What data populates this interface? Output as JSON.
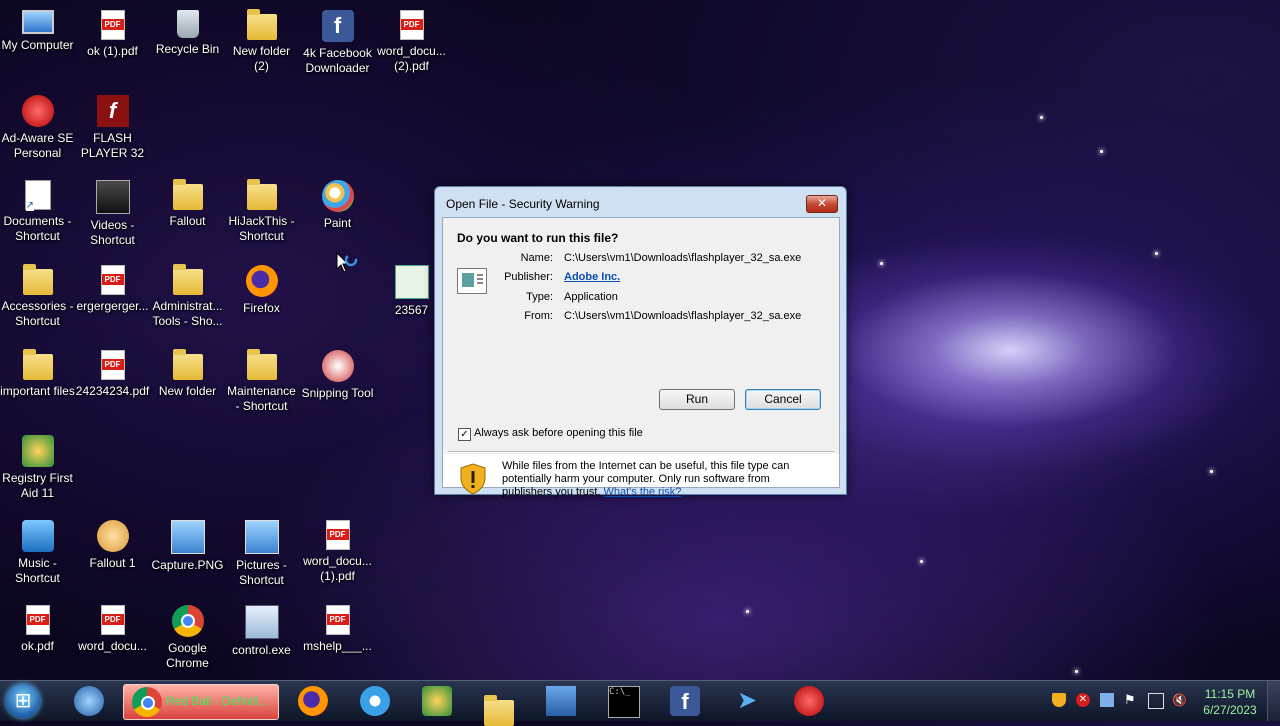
{
  "desktop": {
    "icons": [
      {
        "label": "My Computer",
        "icon": "my-computer-icon"
      },
      {
        "label": "ok (1).pdf",
        "icon": "pdf-icon"
      },
      {
        "label": "Recycle Bin",
        "icon": "recycle-bin-icon"
      },
      {
        "label": "New folder (2)",
        "icon": "folder-icon"
      },
      {
        "label": "4k Facebook Downloader",
        "icon": "facebook-downloader-icon"
      },
      {
        "label": "word_docu... (2).pdf",
        "icon": "pdf-icon"
      },
      {
        "label": "Ad-Aware SE Personal",
        "icon": "adaware-icon"
      },
      {
        "label": "FLASH PLAYER 32",
        "icon": "flash-player-icon"
      },
      {
        "label": "Documents - Shortcut",
        "icon": "documents-shortcut-icon"
      },
      {
        "label": "Videos - Shortcut",
        "icon": "videos-shortcut-icon"
      },
      {
        "label": "Fallout",
        "icon": "folder-icon"
      },
      {
        "label": "HiJackThis - Shortcut",
        "icon": "folder-shortcut-icon"
      },
      {
        "label": "Paint",
        "icon": "paint-icon"
      },
      {
        "label": "Accessories - Shortcut",
        "icon": "folder-shortcut-icon"
      },
      {
        "label": "ergergerger...",
        "icon": "pdf-icon"
      },
      {
        "label": "Administrat... Tools - Sho...",
        "icon": "folder-icon"
      },
      {
        "label": "Firefox",
        "icon": "firefox-icon"
      },
      {
        "label": "23567",
        "icon": "spreadsheet-icon"
      },
      {
        "label": "important files",
        "icon": "folder-shortcut-icon"
      },
      {
        "label": "24234234.pdf",
        "icon": "pdf-icon"
      },
      {
        "label": "New folder",
        "icon": "folder-icon"
      },
      {
        "label": "Maintenance - Shortcut",
        "icon": "folder-shortcut-icon"
      },
      {
        "label": "Snipping Tool",
        "icon": "snipping-tool-icon"
      },
      {
        "label": "Registry First Aid 11",
        "icon": "registry-first-aid-icon"
      },
      {
        "label": "Music - Shortcut",
        "icon": "music-shortcut-icon"
      },
      {
        "label": "Fallout 1",
        "icon": "fallout-icon"
      },
      {
        "label": "Capture.PNG",
        "icon": "png-file-icon"
      },
      {
        "label": "Pictures - Shortcut",
        "icon": "pictures-shortcut-icon"
      },
      {
        "label": "word_docu... (1).pdf",
        "icon": "pdf-icon"
      },
      {
        "label": "ok.pdf",
        "icon": "pdf-icon"
      },
      {
        "label": "word_docu...",
        "icon": "pdf-icon"
      },
      {
        "label": "Google Chrome",
        "icon": "chrome-icon"
      },
      {
        "label": "control.exe",
        "icon": "exe-icon"
      },
      {
        "label": "mshelp___...",
        "icon": "pdf-icon"
      }
    ]
  },
  "dialog": {
    "title": "Open File - Security Warning",
    "close_label": "✕",
    "question": "Do you want to run this file?",
    "name_key": "Name:",
    "name_value": "C:\\Users\\vm1\\Downloads\\flashplayer_32_sa.exe",
    "publisher_key": "Publisher:",
    "publisher_value": "Adobe Inc.",
    "type_key": "Type:",
    "type_value": "Application",
    "from_key": "From:",
    "from_value": "C:\\Users\\vm1\\Downloads\\flashplayer_32_sa.exe",
    "run_label": "Run",
    "cancel_label": "Cancel",
    "always_ask_label": "Always ask before opening this file",
    "always_ask_checked": "✓",
    "warning_text": "While files from the Internet can be useful, this file type can potentially harm your computer. Only run software from publishers you trust.",
    "risk_link": "What's the risk?"
  },
  "taskbar": {
    "active_window_label": "Red Ball - Definiti...",
    "pinned": [
      "network-icon",
      "chrome-icon",
      "firefox-icon",
      "safari-icon",
      "registry-first-aid-icon",
      "file-explorer-icon",
      "task-manager-icon",
      "command-prompt-icon",
      "facebook-downloader-icon",
      "telegram-icon",
      "adaware-icon"
    ],
    "tray_icons": [
      "shield-icon",
      "error-icon",
      "network-icon",
      "flag-icon",
      "display-icon",
      "volume-muted-icon"
    ],
    "time": "11:15 PM",
    "date": "6/27/2023"
  }
}
